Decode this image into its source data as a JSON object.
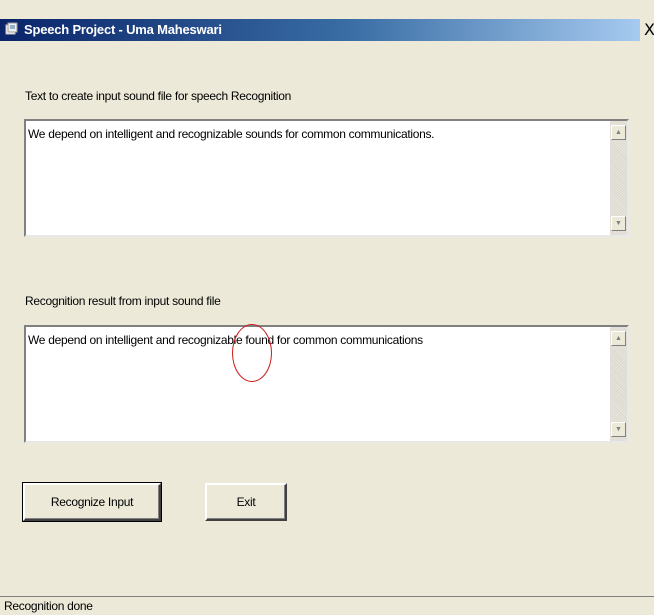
{
  "window": {
    "title": "Speech Project - Uma Maheswari",
    "close_glyph": "X",
    "title_icon": "app-icon"
  },
  "input_section": {
    "label": "Text to create input sound file for speech Recognition",
    "text": "We depend on intelligent and recognizable sounds for common communications."
  },
  "result_section": {
    "label": "Recognition result from input sound file",
    "text": "We depend on intelligent and recognizable found for common communications",
    "circled_word": "found",
    "circle_color": "#cc1b1b"
  },
  "buttons": {
    "recognize": "Recognize Input",
    "exit": "Exit"
  },
  "status": {
    "text": "Recognition done"
  },
  "scrollbar": {
    "up_glyph": "▲",
    "down_glyph": "▼"
  }
}
